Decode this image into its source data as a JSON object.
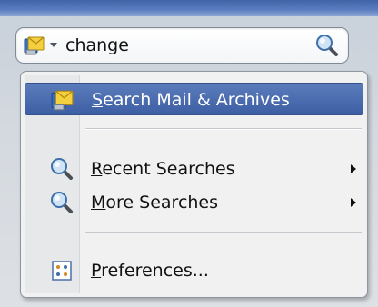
{
  "search": {
    "value": "change",
    "scope_icon": "mail-archive-icon",
    "caret_icon": "chevron-down-icon",
    "search_icon": "magnifier-icon"
  },
  "menu": {
    "items": [
      {
        "accel": "S",
        "rest": "earch Mail & Archives",
        "icon": "mail-archive-icon",
        "selected": true,
        "submenu": false
      },
      {
        "accel": "R",
        "rest": "ecent Searches",
        "icon": "magnifier-icon",
        "selected": false,
        "submenu": true
      },
      {
        "accel": "M",
        "rest": "ore Searches",
        "icon": "magnifier-icon",
        "selected": false,
        "submenu": true
      },
      {
        "accel": "P",
        "rest": "references...",
        "icon": "preferences-icon",
        "selected": false,
        "submenu": false
      }
    ]
  },
  "colors": {
    "selection": "#4a6cb0",
    "topbar": "#4d6fb3",
    "menu_bg": "#f1f1f2"
  }
}
